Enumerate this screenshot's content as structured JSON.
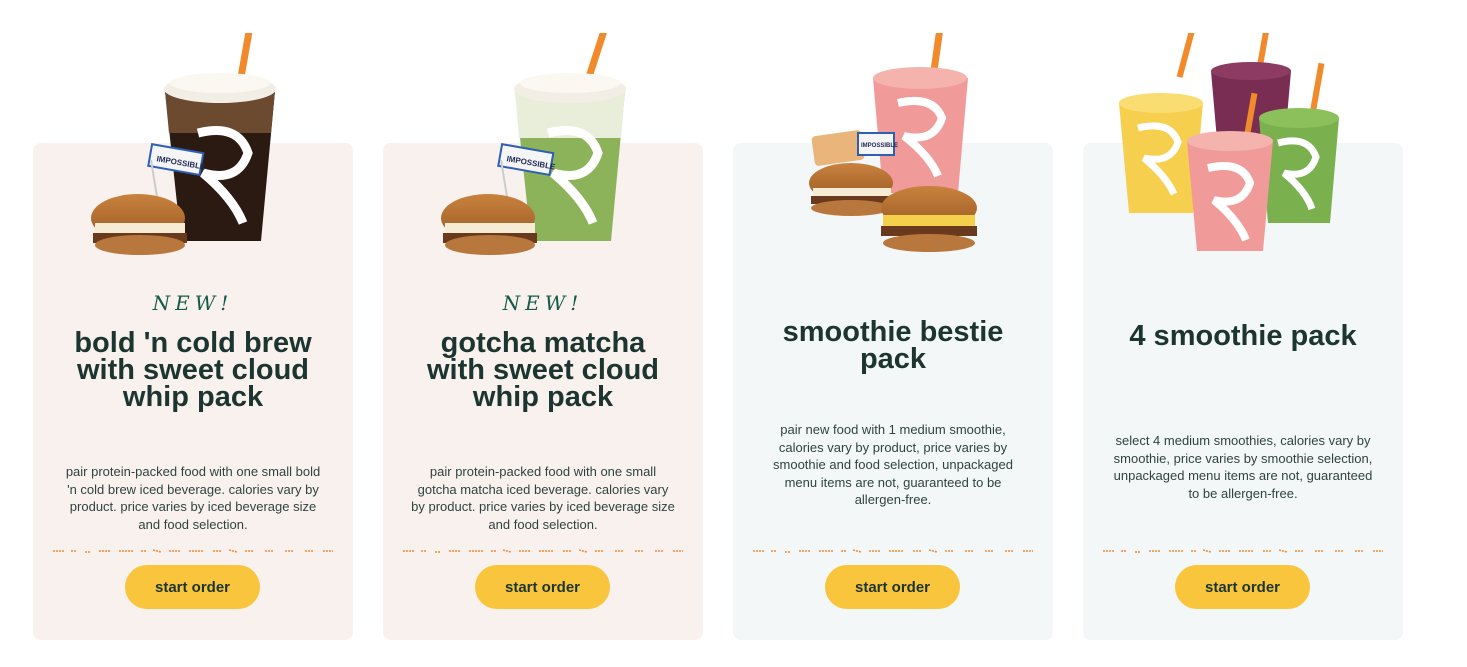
{
  "cards": [
    {
      "badge": "NEW!",
      "title": "bold 'n cold brew with sweet cloud whip pack",
      "description": "pair protein-packed food with one small bold 'n cold brew iced beverage. calories vary by product. price varies by iced beverage size and food selection.",
      "button": "start order",
      "image_icon": "cold-brew-and-sandwich-image"
    },
    {
      "badge": "NEW!",
      "title": "gotcha matcha with sweet cloud whip pack",
      "description": "pair protein-packed food with one small gotcha matcha iced beverage. calories vary by product. price varies by iced beverage size and food selection.",
      "button": "start order",
      "image_icon": "matcha-and-sandwich-image"
    },
    {
      "title": "smoothie bestie pack",
      "description": "pair new food with 1 medium smoothie, calories vary by product, price varies by smoothie and food selection, unpackaged menu items are not, guaranteed to be allergen-free.",
      "button": "start order",
      "image_icon": "smoothie-and-sandwiches-image"
    },
    {
      "title": "4 smoothie pack",
      "description": "select 4 medium smoothies, calories vary by smoothie, price varies by smoothie selection, unpackaged menu items are not, guaranteed to be allergen-free.",
      "button": "start order",
      "image_icon": "four-smoothies-image"
    }
  ],
  "colors": {
    "warm_card": "#f9f1ed",
    "cool_card": "#f3f7f7",
    "button": "#f8c53d",
    "badge": "#135a4a",
    "divider": "#f08a3c"
  }
}
